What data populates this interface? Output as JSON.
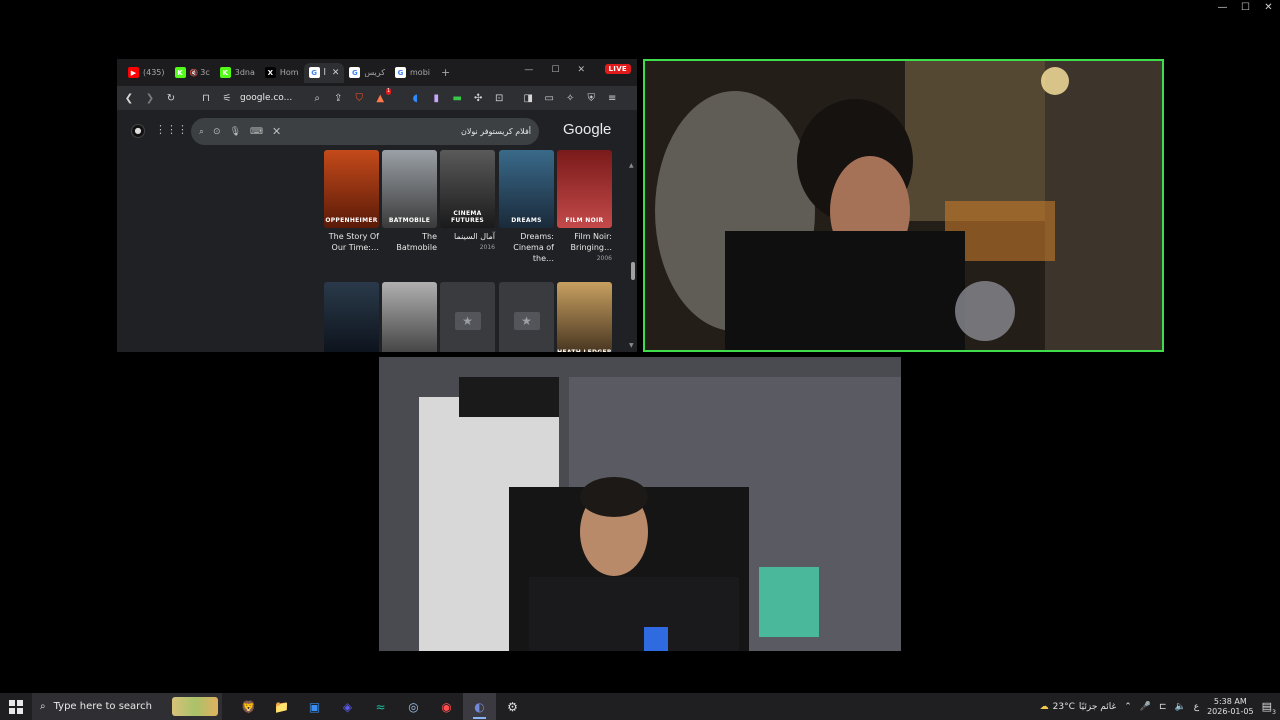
{
  "outer_window": {
    "controls": [
      "—",
      "☐",
      "✕"
    ]
  },
  "browser": {
    "tabs": [
      {
        "icon": "youtube-icon",
        "icon_char": "▶",
        "color": "#ff0000",
        "label": "(435)"
      },
      {
        "icon": "kick-icon",
        "icon_char": "K",
        "color": "#53fc18",
        "label": "3c",
        "muted": "🔇"
      },
      {
        "icon": "kick-icon",
        "icon_char": "K",
        "color": "#53fc18",
        "label": "3dna"
      },
      {
        "icon": "x-icon",
        "icon_char": "X",
        "color": "#000000",
        "label": "Hom"
      },
      {
        "icon": "google-icon",
        "icon_char": "G",
        "color": "#ffffff",
        "label": "أ",
        "active": true
      },
      {
        "icon": "google-icon",
        "icon_char": "G",
        "color": "#ffffff",
        "label": "كريس"
      },
      {
        "icon": "google-icon",
        "icon_char": "G",
        "color": "#ffffff",
        "label": "mobi"
      }
    ],
    "new_tab": "+",
    "window_controls": [
      "—",
      "☐",
      "✕"
    ],
    "live_badge": "LIVE",
    "url": "google.co...",
    "bat_count": "1",
    "google": {
      "search_query": "أفلام كريستوفر نولان",
      "logo": "Google"
    },
    "tiles_row1": [
      {
        "poster_text": "OPPENHEIMER",
        "colors": [
          "#c44a1a",
          "#5a1a08"
        ],
        "caption": "The Story Of Our Time:…",
        "year": ""
      },
      {
        "poster_text": "BATMOBILE",
        "colors": [
          "#9aa0a6",
          "#3a3a3a"
        ],
        "caption": "The Batmobile",
        "year": ""
      },
      {
        "poster_text": "CINEMA FUTURES",
        "colors": [
          "#5a5a5a",
          "#1a1a1a"
        ],
        "caption": "آمال السينما",
        "year": "2016"
      },
      {
        "poster_text": "DREAMS",
        "colors": [
          "#3a6a8a",
          "#1a2a3a"
        ],
        "caption": "Dreams: Cinema of the…",
        "year": ""
      },
      {
        "poster_text": "FILM NOIR",
        "colors": [
          "#7a1a1a",
          "#c44a4a"
        ],
        "caption": "Film Noir: Bringing…",
        "year": "2006"
      }
    ],
    "tiles_row2": [
      {
        "poster_text": "",
        "colors": [
          "#2a3a4a",
          "#0a0f18"
        ],
        "placeholder": false
      },
      {
        "poster_text": "",
        "colors": [
          "#b0b0b0",
          "#3a3a3a"
        ],
        "placeholder": false
      },
      {
        "poster_text": "",
        "placeholder": true
      },
      {
        "poster_text": "",
        "placeholder": true
      },
      {
        "poster_text": "HEATH LEDGER",
        "colors": [
          "#c8a060",
          "#3a2a1a"
        ],
        "placeholder": false
      }
    ]
  },
  "taskbar": {
    "search_placeholder": "Type here to search",
    "apps": [
      {
        "name": "brave-app",
        "glyph": "🦁",
        "color": "#fb542b"
      },
      {
        "name": "file-explorer-app",
        "glyph": "📁",
        "color": "#f2c94c"
      },
      {
        "name": "notes-app",
        "glyph": "▣",
        "color": "#3b8ef0"
      },
      {
        "name": "game-app",
        "glyph": "◈",
        "color": "#5b5bf0"
      },
      {
        "name": "terminal-app",
        "glyph": "≈",
        "color": "#1abc9c"
      },
      {
        "name": "steam-app",
        "glyph": "◎",
        "color": "#9ec1e6"
      },
      {
        "name": "capture-app",
        "glyph": "◉",
        "color": "#ff5050"
      },
      {
        "name": "discord-app",
        "glyph": "◐",
        "color": "#7289da",
        "active": true
      },
      {
        "name": "settings-app",
        "glyph": "⚙",
        "color": "#e0e0e0"
      }
    ],
    "weather_temp": "23°C",
    "weather_text": "غائم جزئيًا",
    "lang": "ع",
    "time": "5:38 AM",
    "date": "2026-01-05",
    "notifications": "3"
  }
}
